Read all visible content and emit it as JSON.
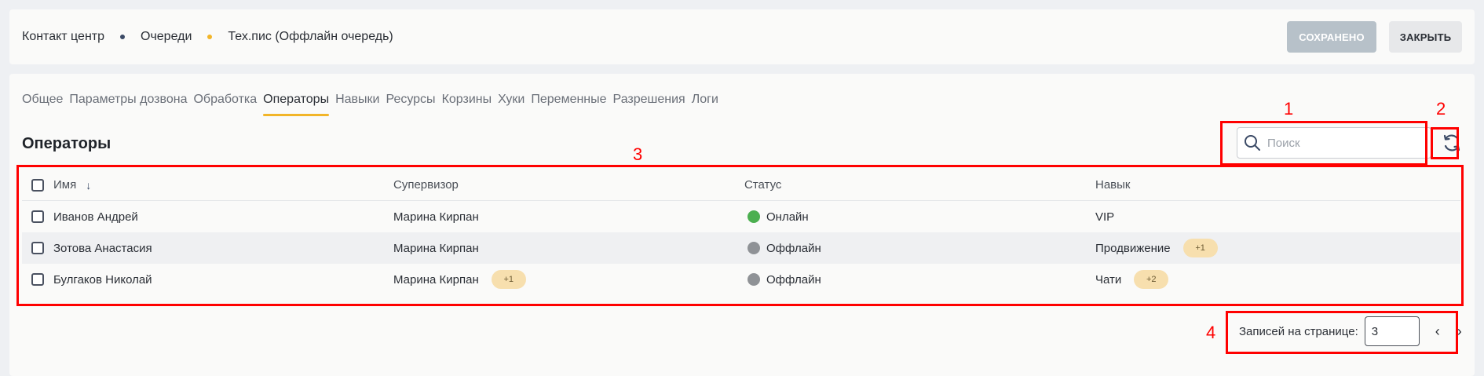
{
  "breadcrumb": {
    "items": [
      "Контакт центр",
      "Очереди",
      "Тех.пис (Оффлайн очередь)"
    ],
    "sep_colors": [
      "#3b4a66",
      "#f2b529"
    ]
  },
  "header_actions": {
    "saved_label": "СОХРАНЕНО",
    "close_label": "ЗАКРЫТЬ"
  },
  "tabs": [
    {
      "label": "Общее"
    },
    {
      "label": "Параметры дозвона"
    },
    {
      "label": "Обработка"
    },
    {
      "label": "Операторы",
      "active": true
    },
    {
      "label": "Навыки"
    },
    {
      "label": "Ресурсы"
    },
    {
      "label": "Корзины"
    },
    {
      "label": "Хуки"
    },
    {
      "label": "Переменные"
    },
    {
      "label": "Разрешения"
    },
    {
      "label": "Логи"
    }
  ],
  "section_title": "Операторы",
  "search": {
    "placeholder": "Поиск",
    "value": ""
  },
  "table": {
    "columns": [
      "Имя",
      "Супервизор",
      "Статус",
      "Навык"
    ],
    "sort_icon": "arrow-down-icon",
    "rows": [
      {
        "name": "Иванов Андрей",
        "supervisor": "Марина Кирпан",
        "supervisor_extra": "",
        "status": "Онлайн",
        "status_color": "#4caf50",
        "skill": "VIP",
        "skill_extra": ""
      },
      {
        "name": "Зотова Анастасия",
        "supervisor": "Марина Кирпан",
        "supervisor_extra": "",
        "status": "Оффлайн",
        "status_color": "#8f9296",
        "skill": "Продвижение",
        "skill_extra": "+1"
      },
      {
        "name": "Булгаков Николай",
        "supervisor": "Марина Кирпан",
        "supervisor_extra": "+1",
        "status": "Оффлайн",
        "status_color": "#8f9296",
        "skill": "Чати",
        "skill_extra": "+2"
      }
    ]
  },
  "pagination": {
    "label": "Записей на странице:",
    "per_page": "3"
  },
  "annotations": [
    "1",
    "2",
    "3",
    "4"
  ],
  "colors": {
    "accent": "#f2b529",
    "annotation": "#ff0000",
    "online": "#4caf50",
    "offline": "#8f9296"
  }
}
